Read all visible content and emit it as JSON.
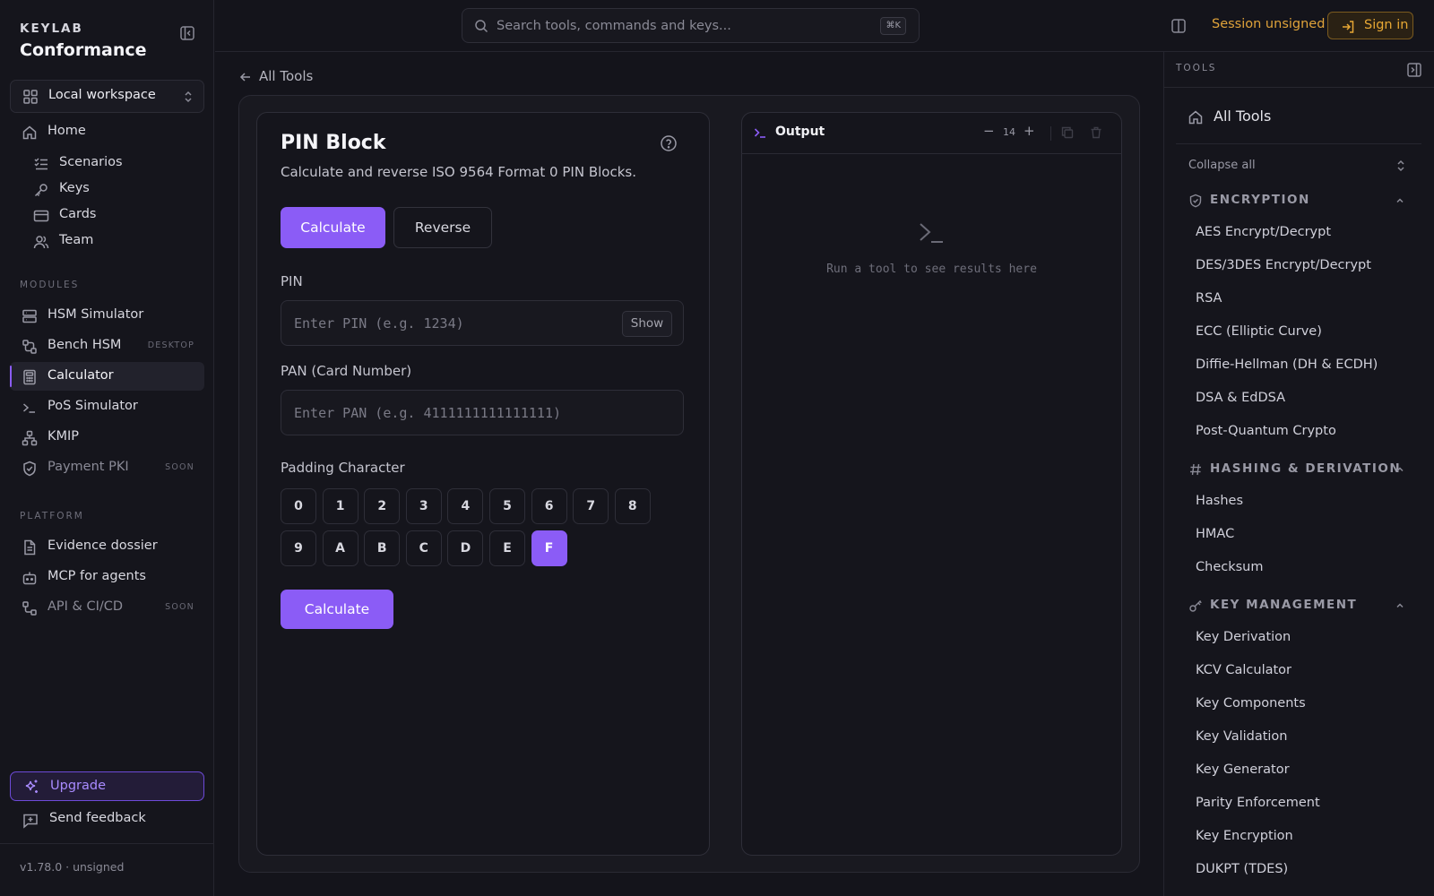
{
  "brand": {
    "small": "KEYLAB",
    "big": "Conformance"
  },
  "workspace": {
    "label": "Local workspace"
  },
  "nav": {
    "home": "Home",
    "sub": [
      "Scenarios",
      "Keys",
      "Cards",
      "Team"
    ]
  },
  "modules": {
    "title": "MODULES",
    "items": [
      {
        "label": "HSM Simulator",
        "tag": ""
      },
      {
        "label": "Bench HSM",
        "tag": "DESKTOP"
      },
      {
        "label": "Calculator",
        "tag": "",
        "active": true
      },
      {
        "label": "PoS Simulator",
        "tag": ""
      },
      {
        "label": "KMIP",
        "tag": ""
      },
      {
        "label": "Payment PKI",
        "tag": "SOON"
      }
    ]
  },
  "platform": {
    "title": "PLATFORM",
    "items": [
      {
        "label": "Evidence dossier",
        "tag": ""
      },
      {
        "label": "MCP for agents",
        "tag": ""
      },
      {
        "label": "API & CI/CD",
        "tag": "SOON"
      }
    ]
  },
  "footer": {
    "upgrade": "Upgrade",
    "feedback": "Send feedback",
    "version": "v1.78.0 · unsigned"
  },
  "topbar": {
    "search_placeholder": "Search tools, commands and keys...",
    "shortcut": "⌘K",
    "session": "Session unsigned",
    "signin": "Sign in"
  },
  "breadcrumb": {
    "back": "All Tools"
  },
  "tool": {
    "title": "PIN Block",
    "description": "Calculate and reverse ISO 9564 Format 0 PIN Blocks.",
    "tabs": {
      "calculate": "Calculate",
      "reverse": "Reverse"
    },
    "pin_label": "PIN",
    "pin_placeholder": "Enter PIN (e.g. 1234)",
    "pin_value": "",
    "show_label": "Show",
    "pan_label": "PAN (Card Number)",
    "pan_placeholder": "Enter PAN (e.g. 4111111111111111)",
    "pan_value": "",
    "padding_label": "Padding Character",
    "padding_chars": [
      "0",
      "1",
      "2",
      "3",
      "4",
      "5",
      "6",
      "7",
      "8",
      "9",
      "A",
      "B",
      "C",
      "D",
      "E",
      "F"
    ],
    "padding_selected": "F",
    "submit": "Calculate"
  },
  "output": {
    "title": "Output",
    "font_size": "14",
    "minus": "−",
    "plus": "+",
    "empty": "Run a tool to see results here"
  },
  "tools_panel": {
    "title": "TOOLS",
    "all_tools": "All Tools",
    "collapse_all": "Collapse all",
    "categories": [
      {
        "name": "ENCRYPTION",
        "icon": "shield-icon",
        "items": [
          "AES Encrypt/Decrypt",
          "DES/3DES Encrypt/Decrypt",
          "RSA",
          "ECC (Elliptic Curve)",
          "Diffie-Hellman (DH & ECDH)",
          "DSA & EdDSA",
          "Post-Quantum Crypto"
        ]
      },
      {
        "name": "HASHING & DERIVATION",
        "icon": "hash-icon",
        "items": [
          "Hashes",
          "HMAC",
          "Checksum"
        ]
      },
      {
        "name": "KEY MANAGEMENT",
        "icon": "key-icon",
        "items": [
          "Key Derivation",
          "KCV Calculator",
          "Key Components",
          "Key Validation",
          "Key Generator",
          "Parity Enforcement",
          "Key Encryption",
          "DUKPT (TDES)"
        ]
      }
    ]
  },
  "colors": {
    "accent": "#8b5cf6",
    "warning": "#e8a834",
    "background": "#14141b"
  }
}
